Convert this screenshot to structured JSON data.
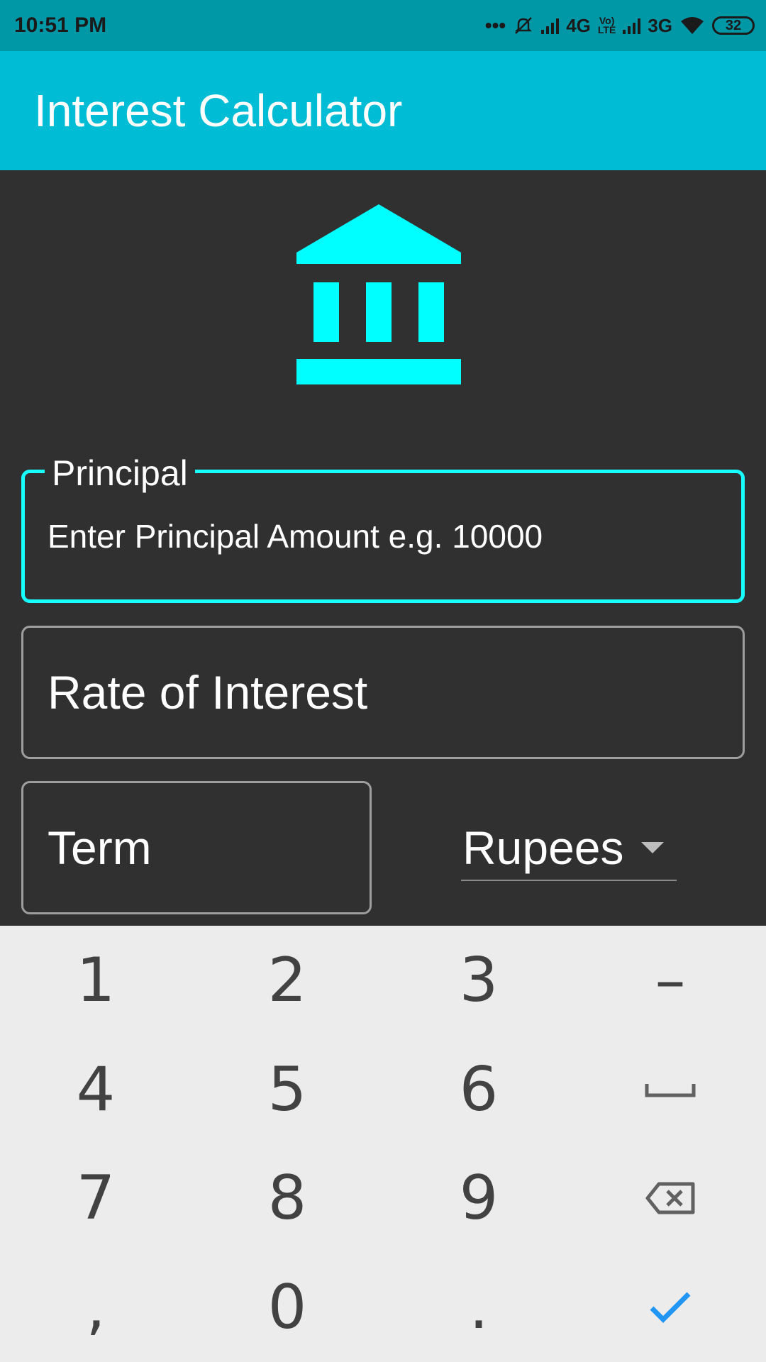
{
  "status_bar": {
    "time": "10:51 PM",
    "network_1": "4G",
    "volte": [
      "Vo)",
      "LTE"
    ],
    "network_2": "3G",
    "battery": "32",
    "icons": [
      "more-dots-icon",
      "mute-icon",
      "signal-icon",
      "signal-icon",
      "wifi-icon",
      "battery-icon"
    ]
  },
  "app_bar": {
    "title": "Interest Calculator"
  },
  "header_icon": {
    "name": "bank-icon",
    "color": "#00ffff"
  },
  "form": {
    "principal": {
      "label": "Principal",
      "placeholder": "Enter Principal Amount   e.g. 10000",
      "focused": true
    },
    "rate": {
      "label": "Rate of Interest"
    },
    "term": {
      "label": "Term"
    },
    "currency": {
      "selected": "Rupees"
    }
  },
  "keyboard": {
    "keys": [
      "1",
      "2",
      "3",
      "–",
      "4",
      "5",
      "6",
      "space",
      "7",
      "8",
      "9",
      "backspace",
      ",",
      "0",
      ".",
      "done"
    ],
    "accent": "#2196f3"
  },
  "colors": {
    "status_bar": "#0097a7",
    "app_bar": "#00bcd4",
    "background": "#303030",
    "focus_outline": "#18ffff"
  }
}
